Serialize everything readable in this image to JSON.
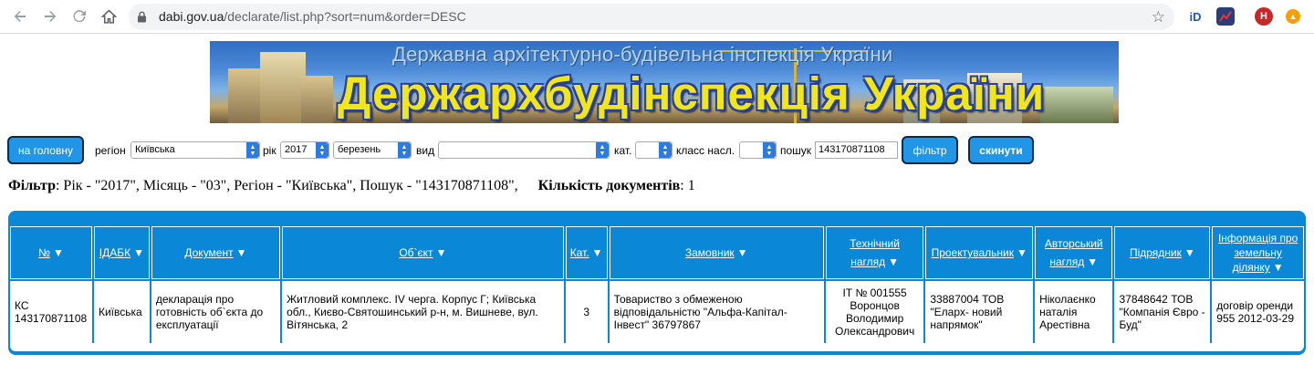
{
  "browser": {
    "url_domain": "dabi.gov.ua",
    "url_path": "/declarate/list.php?sort=num&order=DESC",
    "profile_initial": "H",
    "ext1_label": "iD"
  },
  "banner": {
    "subtitle": "Державна архітектурно-будівельна інспекція України",
    "title": "Держархбудінспекція України"
  },
  "filters": {
    "home_button": "на головну",
    "region_label": "регіон",
    "region_value": "Київська",
    "year_label": "рік",
    "year_value": "2017",
    "month_value": "березень",
    "type_label": "вид",
    "type_value": "",
    "category_label": "кат.",
    "category_value": "",
    "class_label": "класс насл.",
    "class_value": "",
    "search_label": "пошук",
    "search_value": "143170871108",
    "filter_button": "фільтр",
    "reset_button": "скинути"
  },
  "summary": {
    "filter_label": "Фільтр",
    "filter_text": ": Рік - \"2017\", Місяць - \"03\", Регіон - \"Київська\", Пошук - \"143170871108\",",
    "count_label": "Кількість документів",
    "count_text": ": 1"
  },
  "table": {
    "headers": [
      "№",
      "ІДАБК",
      "Документ",
      "Об`єкт",
      "Кат.",
      "Замовник",
      "Технічний нагляд",
      "Проектувальник",
      "Авторський нагляд",
      "Підрядник",
      "Інформація про земельну ділянку"
    ],
    "row": {
      "num": "КС 143170871108",
      "idabk": "Київська",
      "document": "декларація про готовність об`єкта до експлуатації",
      "object": "Житловий комплекс. IV черга. Корпус Г; Київська обл., Києво-Святошинський р-н, м. Вишневе, вул. Вітянська, 2",
      "category": "3",
      "customer": "Товариство з обмеженою відповідальністю \"Альфа-Капітал-Інвест\" 36797867",
      "tech_supervision": "ІТ № 001555 Воронцов Володимир Олександрович",
      "designer": "33887004 ТОВ \"Еларх- новий напрямок\"",
      "author_supervision": "Ніколаєнко наталія Арестівна",
      "contractor": "37848642 ТОВ \"Компанія Євро - Буд\"",
      "land_info": "договір оренди 955 2012-03-29"
    }
  }
}
